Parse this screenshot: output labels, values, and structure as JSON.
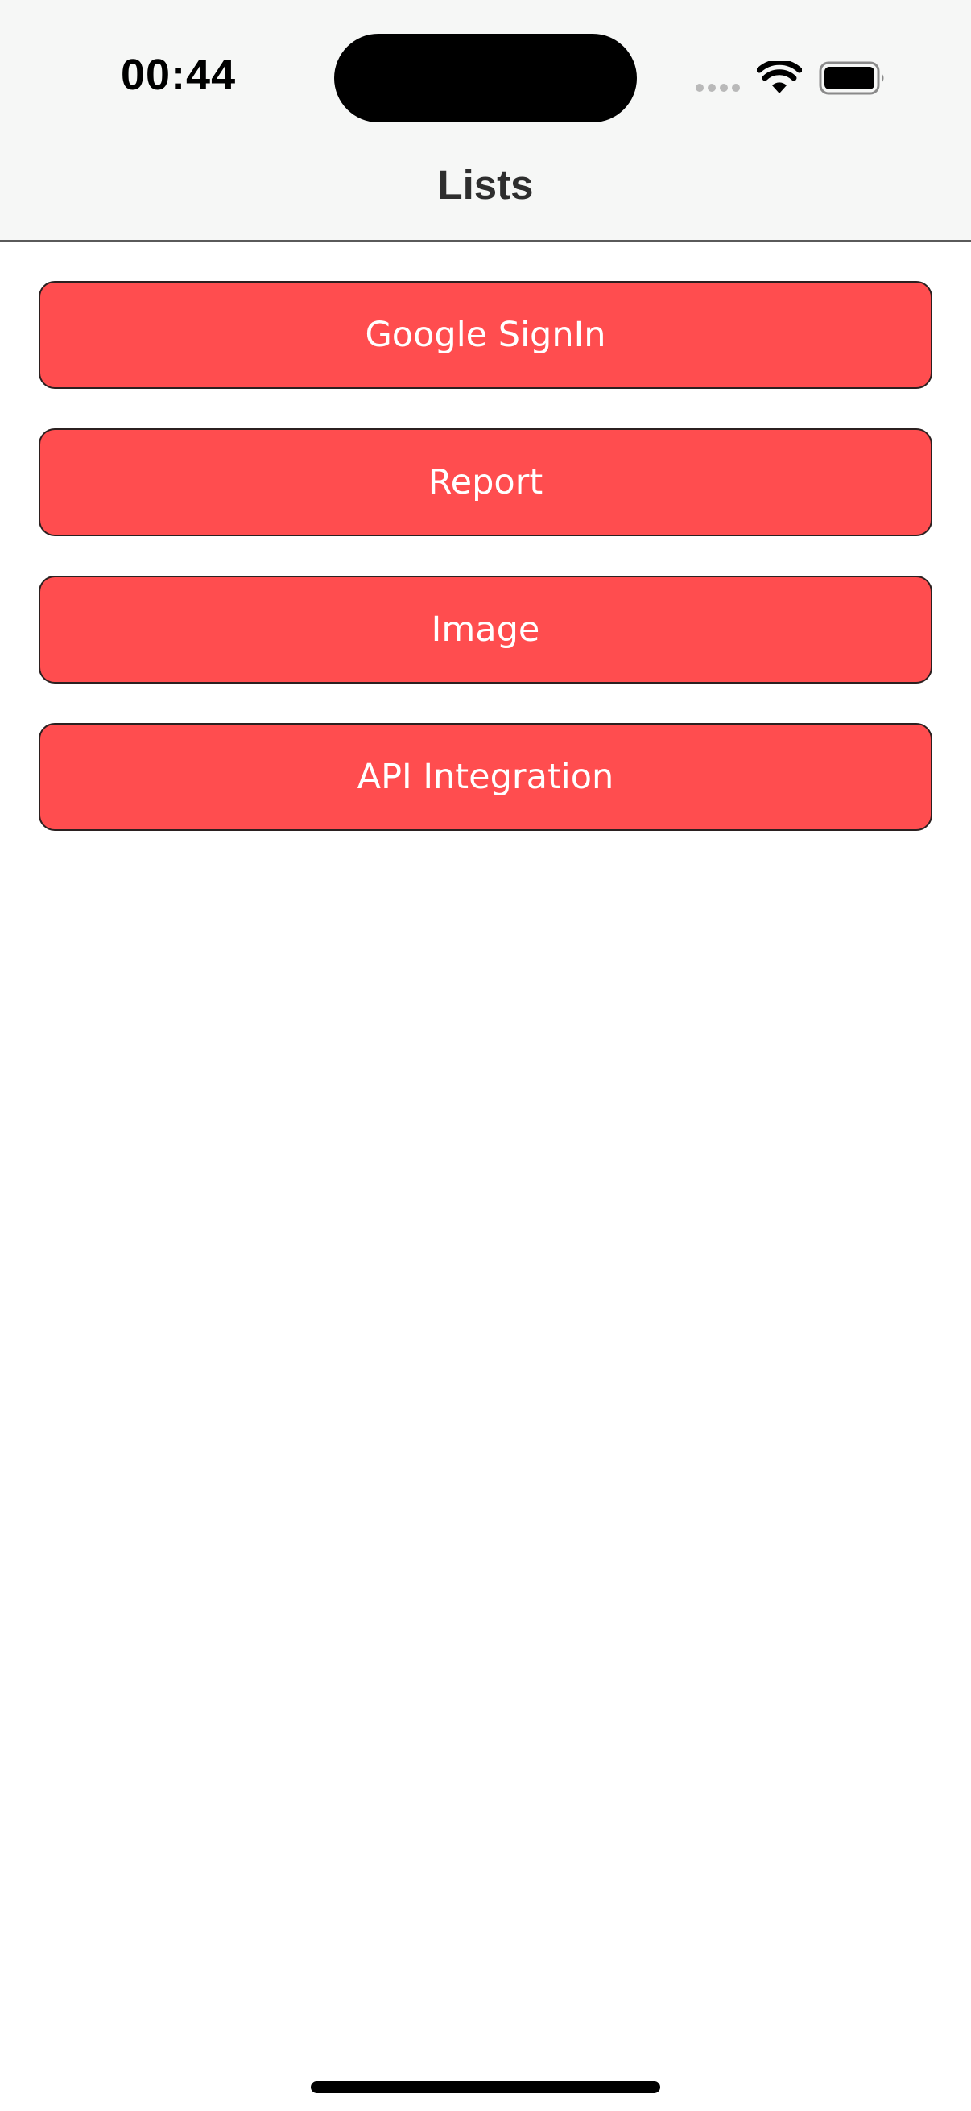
{
  "status_bar": {
    "time": "00:44",
    "icons": [
      "signal-dots-icon",
      "wifi-icon",
      "battery-icon"
    ]
  },
  "nav_bar": {
    "title": "Lists"
  },
  "buttons": [
    {
      "label": "Google SignIn"
    },
    {
      "label": "Report"
    },
    {
      "label": "Image"
    },
    {
      "label": "API Integration"
    }
  ],
  "colors": {
    "button_fill": "#ff4d4f",
    "button_border": "#2b2020",
    "header_background": "#f6f7f6"
  }
}
